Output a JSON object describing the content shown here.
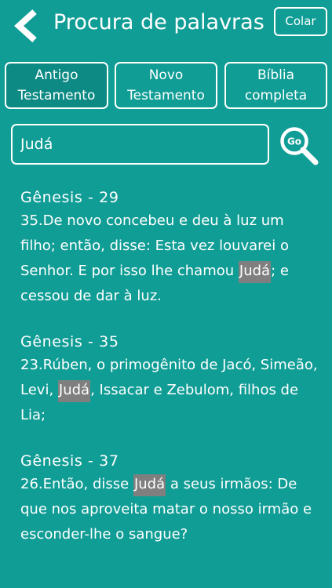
{
  "header": {
    "title": "Procura de palavras",
    "paste_label": "Colar"
  },
  "scopes": [
    {
      "line1": "Antigo",
      "line2": "Testamento"
    },
    {
      "line1": "Novo",
      "line2": "Testamento"
    },
    {
      "line1": "Bíblia",
      "line2": "completa"
    }
  ],
  "search": {
    "value": "Judá",
    "go_label": "Go"
  },
  "results": [
    {
      "ref": "Gênesis - 29",
      "pre": "35.De novo concebeu e deu à luz um filho; então, disse: Esta vez louvarei o Senhor. E por isso lhe chamou ",
      "match": "Judá",
      "post": "; e cessou de dar à luz."
    },
    {
      "ref": "Gênesis - 35",
      "pre": "23.Rúben, o primogênito de Jacó, Simeão, Levi, ",
      "match": "Judá",
      "post": ", Issacar e Zebulom, filhos de Lia;"
    },
    {
      "ref": "Gênesis - 37",
      "pre": "26.Então, disse ",
      "match": "Judá",
      "post": " a seus irmãos: De que nos aproveita matar o nosso irmão e esconder-lhe o sangue?"
    }
  ],
  "colors": {
    "background": "#109d95",
    "highlight": "#7f7f7f",
    "foreground": "#ffffff"
  }
}
